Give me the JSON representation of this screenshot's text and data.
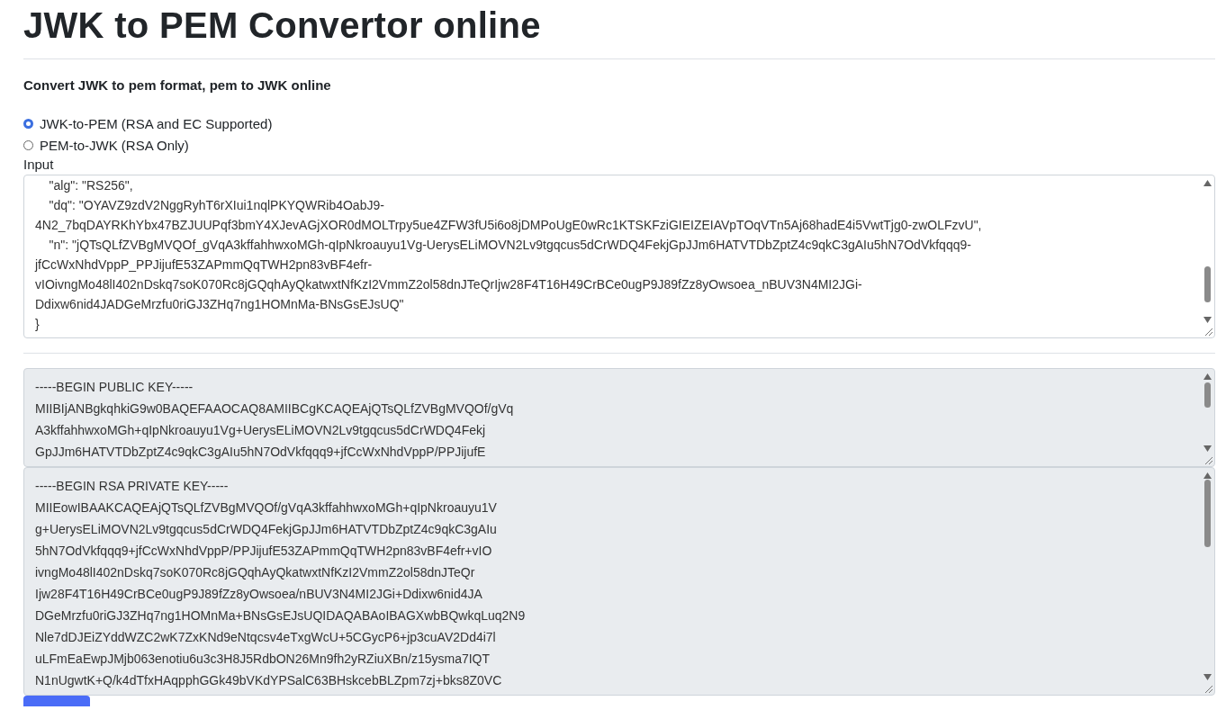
{
  "title": "JWK to PEM Convertor online",
  "subtitle": "Convert JWK to pem format, pem to JWK online",
  "modes": [
    {
      "label": "JWK-to-PEM (RSA and EC Supported)",
      "selected": true
    },
    {
      "label": "PEM-to-JWK (RSA Only)",
      "selected": false
    }
  ],
  "input": {
    "label": "Input",
    "lines": [
      "    \"alg\": \"RS256\",",
      "    \"dq\": \"OYAVZ9zdV2NggRyhT6rXIui1nqlPKYQWRib4OabJ9-",
      "4N2_7bqDAYRKhYbx47BZJUUPqf3bmY4XJevAGjXOR0dMOLTrpy5ue4ZFW3fU5i6o8jDMPoUgE0wRc1KTSKFziGIEIZEIAVpTOqVTn5Aj68hadE4i5VwtTjg0-zwOLFzvU\",",
      "    \"n\": \"jQTsQLfZVBgMVQOf_gVqA3kffahhwxoMGh-qIpNkroauyu1Vg-UerysELiMOVN2Lv9tgqcus5dCrWDQ4FekjGpJJm6HATVTDbZptZ4c9qkC3gAIu5hN7OdVkfqqq9-",
      "jfCcWxNhdVppP_PPJijufE53ZAPmmQqTWH2pn83vBF4efr-",
      "vIOivngMo48lI402nDskq7soK070Rc8jGQqhAyQkatwxtNfKzI2VmmZ2ol58dnJTeQrIjw28F4T16H49CrBCe0ugP9J89fZz8yOwsoea_nBUV3N4MI2JGi-",
      "Ddixw6nid4JADGeMrzfu0riGJ3ZHq7ng1HOMnMa-BNsGsEJsUQ\"",
      "}"
    ]
  },
  "outputs": [
    {
      "lines": [
        "-----BEGIN PUBLIC KEY-----",
        "MIIBIjANBgkqhkiG9w0BAQEFAAOCAQ8AMIIBCgKCAQEAjQTsQLfZVBgMVQOf/gVq",
        "A3kffahhwxoMGh+qIpNkroauyu1Vg+UerysELiMOVN2Lv9tgqcus5dCrWDQ4Fekj",
        "GpJJm6HATVTDbZptZ4c9qkC3gAIu5hN7OdVkfqqq9+jfCcWxNhdVppP/PPJijufE"
      ]
    },
    {
      "lines": [
        "-----BEGIN RSA PRIVATE KEY-----",
        "MIIEowIBAAKCAQEAjQTsQLfZVBgMVQOf/gVqA3kffahhwxoMGh+qIpNkroauyu1V",
        "g+UerysELiMOVN2Lv9tgqcus5dCrWDQ4FekjGpJJm6HATVTDbZptZ4c9qkC3gAIu",
        "5hN7OdVkfqqq9+jfCcWxNhdVppP/PPJijufE53ZAPmmQqTWH2pn83vBF4efr+vIO",
        "ivngMo48lI402nDskq7soK070Rc8jGQqhAyQkatwxtNfKzI2VmmZ2ol58dnJTeQr",
        "Ijw28F4T16H49CrBCe0ugP9J89fZz8yOwsoea/nBUV3N4MI2JGi+Ddixw6nid4JA",
        "DGeMrzfu0riGJ3ZHq7ng1HOMnMa+BNsGsEJsUQIDAQABAoIBAGXwbBQwkqLuq2N9",
        "Nle7dDJEiZYddWZC2wK7ZxKNd9eNtqcsv4eTxgWcU+5CGycP6+jp3cuAV2Dd4i7l",
        "uLFmEaEwpJMjb063enotiu6u3c3H8J5RdbON26Mn9fh2yRZiuXBn/z15ysma7IQT",
        "N1nUgwtK+Q/k4dTfxHAqpphGGk49bVKdYPSalC63BHskcebBLZpm7zj+bks8Z0VC"
      ]
    }
  ]
}
